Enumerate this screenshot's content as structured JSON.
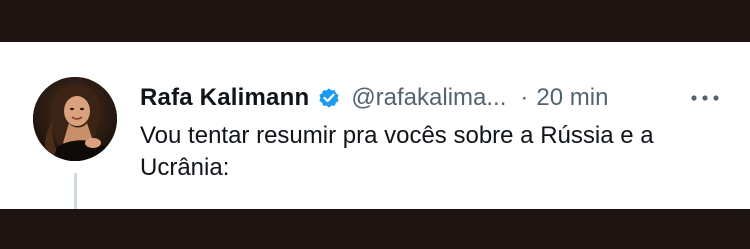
{
  "tweet": {
    "display_name": "Rafa Kalimann",
    "handle": "@rafakalima...",
    "separator": "·",
    "time": "20 min",
    "text_line1": "Vou tentar resumir pra vocês sobre a Rússia e a",
    "text_line2": "Ucrânia:",
    "verified": true,
    "avatar_icon": "user-avatar-photo",
    "more_icon": "more-options-icon"
  },
  "colors": {
    "text_primary": "#0f1419",
    "text_secondary": "#536471",
    "verified_badge": "#1d9bf0",
    "frame": "#1e1412"
  }
}
